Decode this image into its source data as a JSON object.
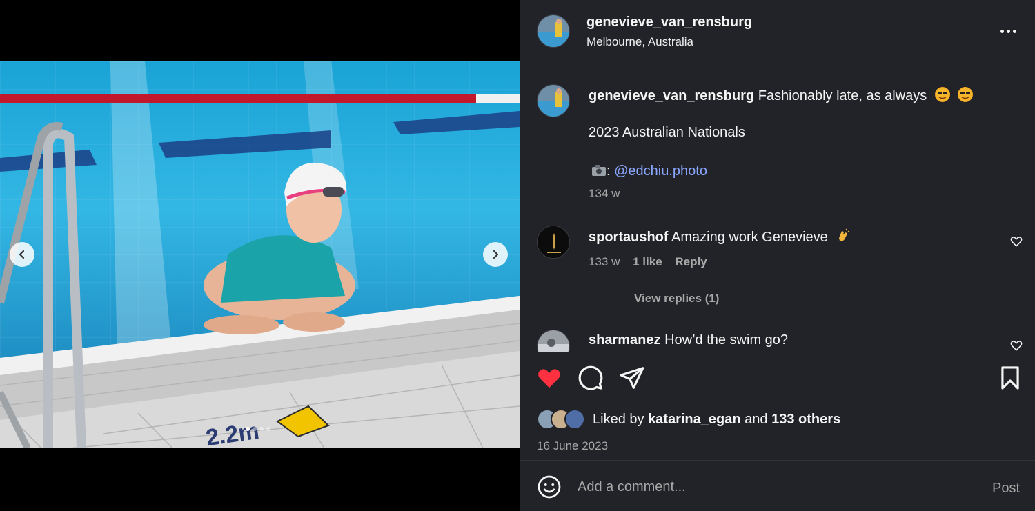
{
  "post": {
    "username": "genevieve_van_rensburg",
    "location": "Melbourne, Australia",
    "more_icon": "more-options-icon"
  },
  "carousel": {
    "pool_depth_label": "2.2m",
    "prev_icon": "chevron-left-icon",
    "next_icon": "chevron-right-icon",
    "slide_count": 4,
    "active_slide": 1
  },
  "caption": {
    "username": "genevieve_van_rensburg",
    "text": "Fashionably late, as always",
    "line2": "2023 Australian Nationals",
    "camera_prefix": ":",
    "mention": "@edchiu.photo",
    "time": "134 w"
  },
  "comments": [
    {
      "username": "sportaushof",
      "text": "Amazing work Genevieve",
      "time": "133 w",
      "likes": "1 like",
      "reply_label": "Reply",
      "view_replies": "View replies (1)"
    },
    {
      "username": "sharmanez",
      "text": "How’d the swim go?"
    }
  ],
  "actions": {
    "liked_by_prefix": "Liked by",
    "liked_by_user": "katarina_egan",
    "and_label": "and",
    "others": "133 others",
    "date": "16 June 2023",
    "liked": true,
    "like_color": "#ff3040"
  },
  "composer": {
    "placeholder": "Add a comment...",
    "post_label": "Post"
  },
  "colors": {
    "panel_bg": "#212328",
    "link": "#8aa6ff",
    "secondary_text": "#a8a8a8"
  }
}
